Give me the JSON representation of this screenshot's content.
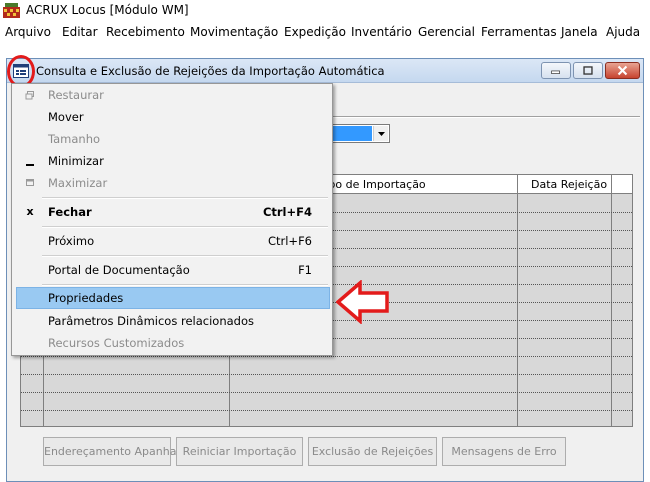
{
  "app": {
    "title": "ACRUX Locus [Módulo WM]"
  },
  "menubar": [
    {
      "label": "Arquivo"
    },
    {
      "label": "Editar"
    },
    {
      "label": "Recebimento"
    },
    {
      "label": "Movimentação"
    },
    {
      "label": "Expedição"
    },
    {
      "label": "Inventário"
    },
    {
      "label": "Gerencial"
    },
    {
      "label": "Ferramentas"
    },
    {
      "label": "Janela"
    },
    {
      "label": "Ajuda"
    }
  ],
  "child_window": {
    "title": "Consulta e Exclusão de Rejeições da Importação Automática"
  },
  "grid": {
    "columns": [
      "Tipo de Importação",
      "Data Rejeição"
    ]
  },
  "buttons": [
    {
      "label": "Endereçamento Apanha"
    },
    {
      "label": "Reiniciar Importação"
    },
    {
      "label": "Exclusão de Rejeições"
    },
    {
      "label": "Mensagens de Erro"
    }
  ],
  "system_menu": {
    "items": [
      {
        "label": "Restaurar",
        "shortcut": "",
        "enabled": false,
        "icon": "restore-icon"
      },
      {
        "label": "Mover",
        "shortcut": "",
        "enabled": true
      },
      {
        "label": "Tamanho",
        "shortcut": "",
        "enabled": false
      },
      {
        "label": "Minimizar",
        "shortcut": "",
        "enabled": true,
        "icon": "minimize-icon"
      },
      {
        "label": "Maximizar",
        "shortcut": "",
        "enabled": false,
        "icon": "maximize-icon"
      },
      {
        "label": "Fechar",
        "shortcut": "Ctrl+F4",
        "enabled": true,
        "bold": true,
        "icon": "close-icon",
        "glyph": "x"
      },
      {
        "label": "Próximo",
        "shortcut": "Ctrl+F6",
        "enabled": true
      },
      {
        "label": "Portal de Documentação",
        "shortcut": "F1",
        "enabled": true
      },
      {
        "label": "Propriedades",
        "shortcut": "",
        "enabled": true,
        "highlighted": true
      },
      {
        "label": "Parâmetros Dinâmicos relacionados",
        "shortcut": "",
        "enabled": true
      },
      {
        "label": "Recursos Customizados",
        "shortcut": "",
        "enabled": false
      }
    ]
  },
  "colors": {
    "annotation": "#e31b1b",
    "highlight": "#99c9f2",
    "combo_selection": "#3399ff"
  }
}
